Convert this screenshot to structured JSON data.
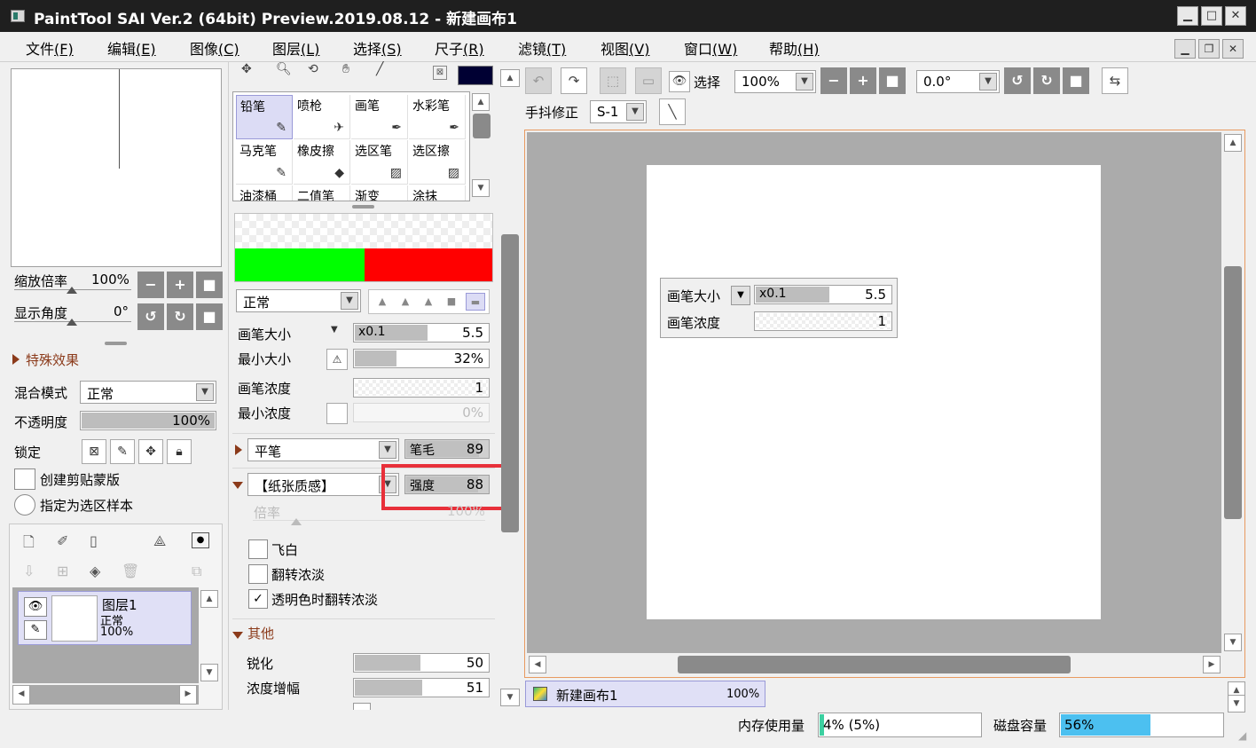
{
  "window": {
    "title": "PaintTool SAI Ver.2 (64bit) Preview.2019.08.12 - 新建画布1",
    "minimize": "▁",
    "maximize": "□",
    "close": "✕"
  },
  "menu": [
    {
      "label": "文件",
      "key": "(F)"
    },
    {
      "label": "编辑",
      "key": "(E)"
    },
    {
      "label": "图像",
      "key": "(C)"
    },
    {
      "label": "图层",
      "key": "(L)"
    },
    {
      "label": "选择",
      "key": "(S)"
    },
    {
      "label": "尺子",
      "key": "(R)"
    },
    {
      "label": "滤镜",
      "key": "(T)"
    },
    {
      "label": "视图",
      "key": "(V)"
    },
    {
      "label": "窗口",
      "key": "(W)"
    },
    {
      "label": "帮助",
      "key": "(H)"
    }
  ],
  "navigator": {
    "zoom_label": "缩放倍率",
    "zoom_value": "100%",
    "angle_label": "显示角度",
    "angle_value": "0°"
  },
  "effects": {
    "section_label": "特殊效果",
    "blend_label": "混合模式",
    "blend_value": "正常",
    "opacity_label": "不透明度",
    "opacity_value": "100%",
    "opacity_fraction": 1.0,
    "lock_label": "锁定",
    "clip_label": "创建剪贴蒙版",
    "selection_source_label": "指定为选区样本"
  },
  "layers": [
    {
      "name": "图层1",
      "mode": "正常",
      "opacity": "100%"
    }
  ],
  "tools": [
    {
      "label": "铅笔",
      "icon": "✎",
      "selected": true
    },
    {
      "label": "喷枪",
      "icon": "✈",
      "selected": false
    },
    {
      "label": "画笔",
      "icon": "✒",
      "selected": false
    },
    {
      "label": "水彩笔",
      "icon": "✒",
      "selected": false
    },
    {
      "label": "马克笔",
      "icon": "✎",
      "selected": false
    },
    {
      "label": "橡皮擦",
      "icon": "◆",
      "selected": false
    },
    {
      "label": "选区笔",
      "icon": "▨",
      "selected": false
    },
    {
      "label": "选区擦",
      "icon": "▨",
      "selected": false
    },
    {
      "label": "油漆桶",
      "icon": "",
      "selected": false
    },
    {
      "label": "二值笔",
      "icon": "",
      "selected": false
    },
    {
      "label": "渐变",
      "icon": "",
      "selected": false
    },
    {
      "label": "涂抹",
      "icon": "",
      "selected": false
    }
  ],
  "colors": {
    "primary": "#00ff00",
    "secondary": "#ff0000",
    "foreground_swatch": "#000033",
    "accent_highlight": "#e8303a"
  },
  "brush": {
    "mode": "正常",
    "size_label": "画笔大小",
    "size_multiplier": "x0.1",
    "size_value": "5.5",
    "size_fraction": 0.55,
    "min_size_label": "最小大小",
    "min_size_value": "32%",
    "min_size_fraction": 0.32,
    "density_label": "画笔浓度",
    "density_value": "1",
    "min_density_label": "最小浓度",
    "min_density_value": "0%",
    "shape_name": "平笔",
    "shape_param_label": "笔毛",
    "shape_param_value": "89",
    "shape_param_fraction": 0.89,
    "texture_name": "【纸张质感】",
    "texture_param_label": "强度",
    "texture_param_value": "88",
    "texture_param_fraction": 0.88,
    "scale_label": "倍率",
    "scale_value": "100%",
    "opt_blank": "飞白",
    "opt_invert": "翻转浓淡",
    "opt_invert_transparent": "透明色时翻转浓淡",
    "other_label": "其他",
    "sharp_label": "锐化",
    "sharp_value": "50",
    "sharp_fraction": 0.5,
    "gain_label": "浓度增幅",
    "gain_value": "51",
    "gain_fraction": 0.51
  },
  "toolbar": {
    "select_label": "选择",
    "zoom_value": "100%",
    "angle_value": "0.0°",
    "stabilizer_label": "手抖修正",
    "stabilizer_value": "S-1"
  },
  "canvas_popup": {
    "size_label": "画笔大小",
    "size_multiplier": "x0.1",
    "size_value": "5.5",
    "density_label": "画笔浓度",
    "density_value": "1"
  },
  "tabs": [
    {
      "name": "新建画布1",
      "zoom": "100%"
    }
  ],
  "status": {
    "memory_label": "内存使用量",
    "memory_value": "4% (5%)",
    "memory_fraction": 0.04,
    "disk_label": "磁盘容量",
    "disk_value": "56%",
    "disk_fraction": 0.56
  }
}
